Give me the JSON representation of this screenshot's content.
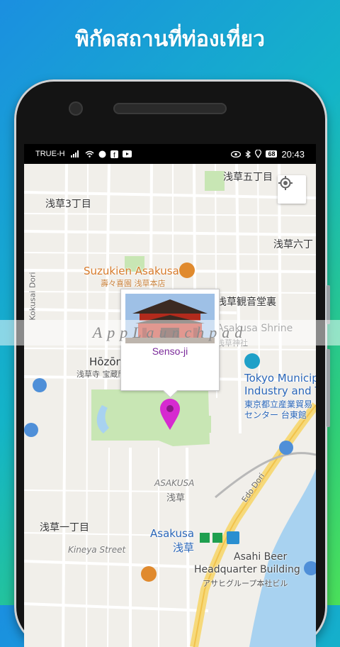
{
  "headline": "พิกัดสถานที่ท่องเที่ยว",
  "status_bar": {
    "carrier": "TRUE-H",
    "battery": "68",
    "time": "20:43"
  },
  "map": {
    "labels": {
      "asakusa5": "浅草五丁目",
      "asakusa3": "浅草3丁目",
      "asakusa6": "浅草六丁",
      "suzukien": "Suzukien Asakusa",
      "suzukien_jp": "壽々喜園 浅草本店",
      "kannon": "浅草観音堂裏",
      "shrine": "Asakusa Shrine",
      "shrine_jp": "浅草神社",
      "hozomon": "Hōzōmon",
      "hozomon_jp": "浅草寺 宝蔵門(仁王門)",
      "tokyo_muni": "Tokyo Municip",
      "tokyo_muni2": "Industry and T",
      "tokyo_muni_jp": "東京都立産業貿易",
      "tokyo_muni_jp2": "センター 台東館",
      "asakusa_area": "ASAKUSA",
      "asakusa_area_jp": "浅草",
      "asakusa1": "浅草一丁目",
      "kineya": "Kineya Street",
      "edo_dori": "Edo Dori",
      "kokusai_dori": "Kokusai Dori",
      "station": "Asakusa",
      "station_jp": "浅草",
      "asahi1": "Asahi Beer",
      "asahi2": "Headquarter Building",
      "asahi_jp": "アサヒグループ本社ビル"
    },
    "info_window": {
      "title": "Senso-ji"
    }
  },
  "watermark": "AppLaunchpad",
  "colors": {
    "pin": "#d62ad0",
    "park": "#c8e6b4",
    "water": "#a8d2f0"
  }
}
